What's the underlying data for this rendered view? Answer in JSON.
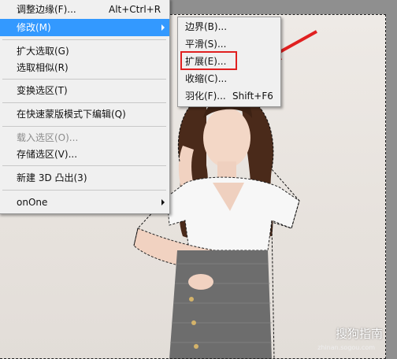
{
  "main_menu": {
    "items": [
      {
        "label": "调整边缘(F)...",
        "shortcut": "Alt+Ctrl+R"
      },
      {
        "label": "修改(M)",
        "submenu": true,
        "highlighted": true
      },
      {
        "label": "扩大选取(G)"
      },
      {
        "label": "选取相似(R)"
      },
      {
        "label": "变换选区(T)"
      },
      {
        "label": "在快速蒙版模式下编辑(Q)"
      },
      {
        "label": "载入选区(O)...",
        "disabled": true
      },
      {
        "label": "存储选区(V)..."
      },
      {
        "label": "新建 3D 凸出(3)"
      },
      {
        "label": "onOne",
        "submenu": true
      }
    ]
  },
  "sub_menu": {
    "items": [
      {
        "label": "边界(B)..."
      },
      {
        "label": "平滑(S)..."
      },
      {
        "label": "扩展(E)...",
        "emphasized": true
      },
      {
        "label": "收缩(C)..."
      },
      {
        "label": "羽化(F)...",
        "shortcut": "Shift+F6"
      }
    ]
  },
  "annotation": {
    "box_color": "#e02020",
    "arrow_color": "#e02020"
  },
  "watermark": {
    "text": "搜狗指南",
    "url": "zhinan.sogou.com"
  },
  "colors": {
    "highlight": "#3399ff",
    "menu_bg": "#f0f0f0",
    "canvas": "#8f8f8f"
  }
}
